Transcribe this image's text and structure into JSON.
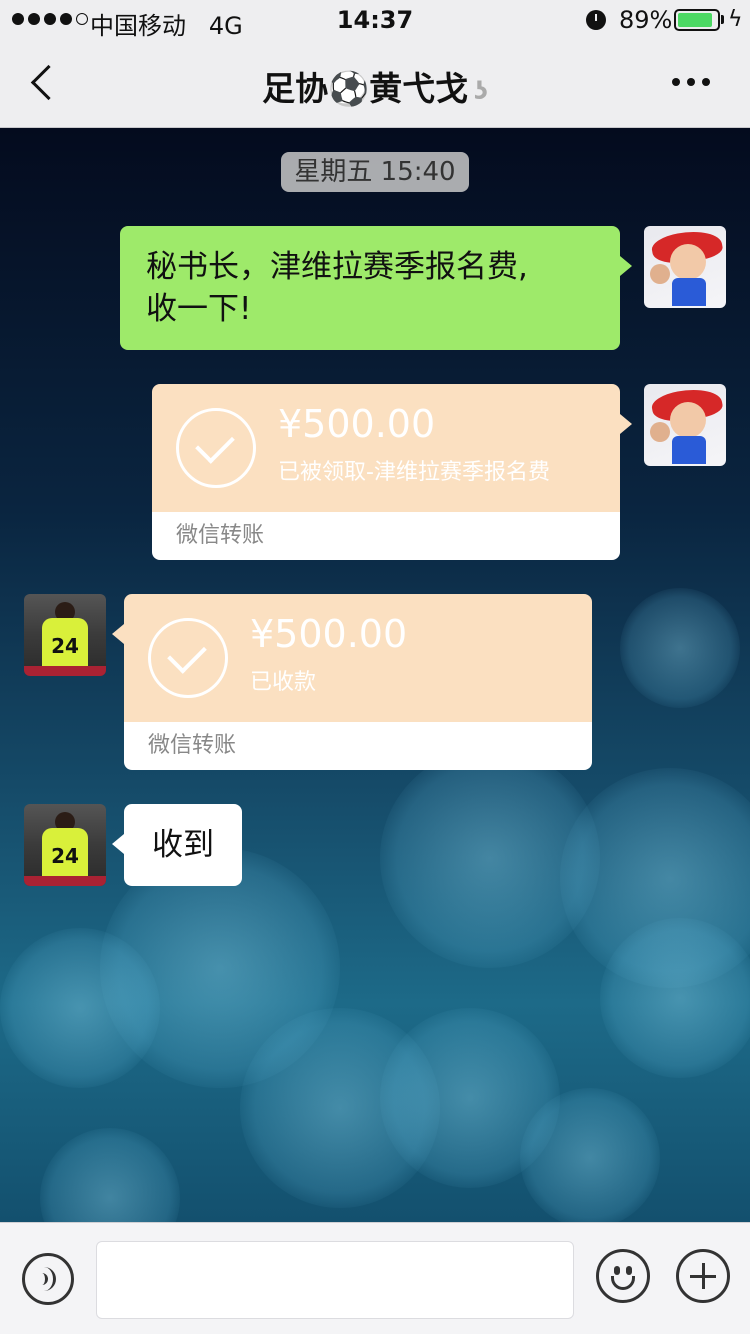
{
  "status_bar": {
    "carrier": "中国移动",
    "network": "4G",
    "time": "14:37",
    "battery_percent": "89%",
    "battery_level": 0.89,
    "signal_bars": 4
  },
  "nav": {
    "title": "足协⚽黄弋戈",
    "ear_icon": "ear-icon"
  },
  "chat": {
    "timestamp": "星期五 15:40",
    "messages": [
      {
        "type": "text",
        "side": "right",
        "text_line1": "秘书长，津维拉赛季报名费,",
        "text_line2": "收一下!"
      },
      {
        "type": "transfer",
        "side": "right",
        "amount": "¥500.00",
        "note": "已被领取-津维拉赛季报名费",
        "footer": "微信转账"
      },
      {
        "type": "transfer",
        "side": "left",
        "amount": "¥500.00",
        "note": "已收款",
        "footer": "微信转账"
      },
      {
        "type": "text",
        "side": "left",
        "text": "收到"
      }
    ],
    "player_jersey_number": "24"
  },
  "colors": {
    "green_bubble": "#9eea6a",
    "transfer_card": "#fbe0c1",
    "battery_green": "#4cd964"
  }
}
